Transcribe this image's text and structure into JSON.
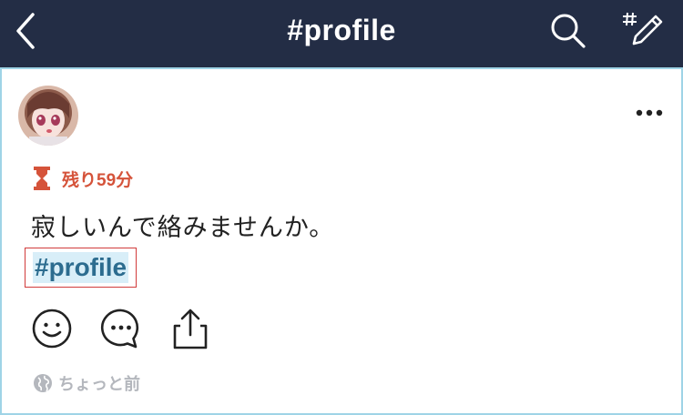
{
  "header": {
    "title": "#profile",
    "back_icon": "chevron-left-icon",
    "search_icon": "search-icon",
    "compose_icon": "hashtag-pencil-icon",
    "background_color": "#232d45"
  },
  "post": {
    "timer_icon": "hourglass-icon",
    "time_remaining": "残り59分",
    "text": "寂しいんで絡みませんか。",
    "hashtag": "#profile",
    "more_icon": "more-horizontal-icon",
    "actions": [
      {
        "icon": "smiley-icon"
      },
      {
        "icon": "comment-icon"
      },
      {
        "icon": "share-icon"
      }
    ],
    "visibility_icon": "globe-icon",
    "posted_time": "ちょっと前",
    "accent_color": "#d5533a",
    "hashtag_color": "#2c6c8f"
  }
}
